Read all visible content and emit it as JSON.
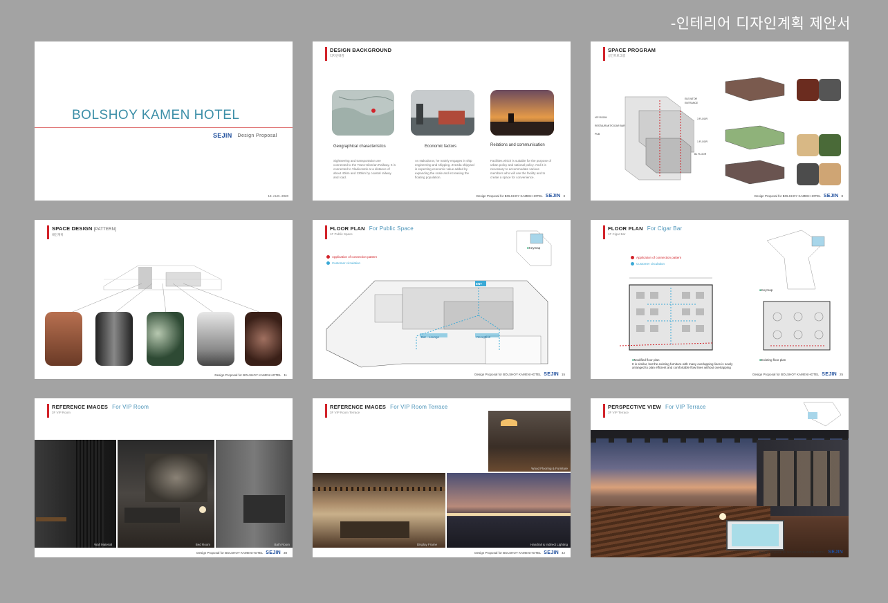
{
  "header": {
    "title": "-인테리어 디자인계획 제안서"
  },
  "brand": {
    "logo": "SEJIN",
    "footer_text": "Design Proposal for BOLSHOY KAMEN HOTEL"
  },
  "slides": {
    "cover": {
      "title": "BOLSHOY KAMEN HOTEL",
      "subtitle": "Design Proposal",
      "date": "13. AUG. 2020"
    },
    "background": {
      "title": "DESIGN BACKGROUND",
      "kor": "디자인배경",
      "page": "3",
      "items": [
        {
          "title": "Geographical characteristics",
          "text": "Sightseeing and transportation are connected to the Trans-Siberian Railway. It is connected to Vladivostok at a distance of about 40km and 130km by coastal railway and road."
        },
        {
          "title": "Economic factors",
          "text": "As Nakodorov, he mainly engages in ship engineering and shipping. Zvezda shipyard is expecting economic value added by expanding the scale and increasing the floating population."
        },
        {
          "title": "Relations and communication",
          "text": "Facilities which is suitable for the purpose of urban policy and national policy. And it is necessary to accommodate various members who will use the facility and to create a space for convenience."
        }
      ]
    },
    "program": {
      "title": "SPACE PROGRAM",
      "kor": "공간프로그램",
      "page": "8",
      "labels": [
        "VIP ROOM",
        "RESTAURANT/CIGAR BAR",
        "PUB",
        "ELEVATOR",
        "ENTRANCE",
        "3 FLOOR",
        "1 FLOOR",
        "B1 FLOOR"
      ]
    },
    "space_design": {
      "title": "SPACE DESIGN",
      "tag": "[PATTERN]",
      "kor": "패턴계획",
      "page": "11"
    },
    "floor_public": {
      "title": "FLOOR PLAN",
      "sub": "For Public Space",
      "kor": "1F Public Space",
      "page": "15",
      "legend": [
        "Application of connection pattern",
        "Customer circulation"
      ],
      "keymap": "Keymap",
      "labels": [
        "ENT",
        "Bar - Lounge",
        "Reception"
      ]
    },
    "floor_cigar": {
      "title": "FLOOR PLAN",
      "sub": "For Cigar Bar",
      "kor": "1F Cigar Bar",
      "page": "25",
      "legend": [
        "Application of connection pattern",
        "Customer circulation"
      ],
      "keymap": "Keymap",
      "modified": "Modified floor plan",
      "modified_text": "It is similar, but the existing furniture with many overlapping lines is newly arranged to plan efficient and comfortable flow lines without overlapping",
      "existing": "Existing floor plan"
    },
    "ref_vip": {
      "title": "REFERENCE IMAGES",
      "sub": "For VIP Room",
      "kor": "3F VIP Room",
      "page": "38",
      "captions": [
        "Wall Material",
        "Bed Room",
        "Bath Room"
      ]
    },
    "ref_terrace": {
      "title": "REFERENCE IMAGES",
      "sub": "For VIP Room Terrace",
      "kor": "3F VIP Room Terrace",
      "page": "42",
      "captions": [
        "Wood Flooring & Furniture",
        "Display Frame",
        "Handrail & Indirect Lighting"
      ]
    },
    "perspective": {
      "title": "PERSPECTIVE VIEW",
      "sub": "For VIP Terrace",
      "kor": "3F VIP Terrace"
    }
  },
  "colors": {
    "accent_red": "#d2232a",
    "accent_blue": "#4a93b8",
    "brand_blue": "#1e4e9c"
  }
}
